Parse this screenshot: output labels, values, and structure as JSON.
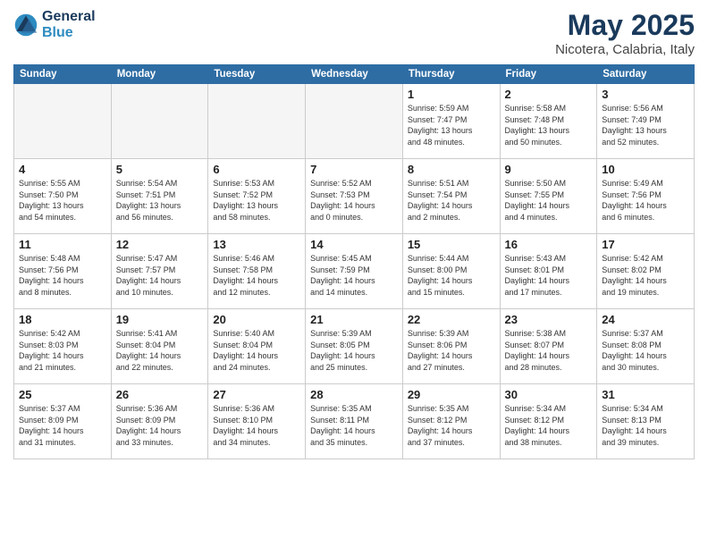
{
  "header": {
    "logo_line1": "General",
    "logo_line2": "Blue",
    "title": "May 2025",
    "subtitle": "Nicotera, Calabria, Italy"
  },
  "days_of_week": [
    "Sunday",
    "Monday",
    "Tuesday",
    "Wednesday",
    "Thursday",
    "Friday",
    "Saturday"
  ],
  "weeks": [
    [
      {
        "day": "",
        "info": ""
      },
      {
        "day": "",
        "info": ""
      },
      {
        "day": "",
        "info": ""
      },
      {
        "day": "",
        "info": ""
      },
      {
        "day": "1",
        "info": "Sunrise: 5:59 AM\nSunset: 7:47 PM\nDaylight: 13 hours\nand 48 minutes."
      },
      {
        "day": "2",
        "info": "Sunrise: 5:58 AM\nSunset: 7:48 PM\nDaylight: 13 hours\nand 50 minutes."
      },
      {
        "day": "3",
        "info": "Sunrise: 5:56 AM\nSunset: 7:49 PM\nDaylight: 13 hours\nand 52 minutes."
      }
    ],
    [
      {
        "day": "4",
        "info": "Sunrise: 5:55 AM\nSunset: 7:50 PM\nDaylight: 13 hours\nand 54 minutes."
      },
      {
        "day": "5",
        "info": "Sunrise: 5:54 AM\nSunset: 7:51 PM\nDaylight: 13 hours\nand 56 minutes."
      },
      {
        "day": "6",
        "info": "Sunrise: 5:53 AM\nSunset: 7:52 PM\nDaylight: 13 hours\nand 58 minutes."
      },
      {
        "day": "7",
        "info": "Sunrise: 5:52 AM\nSunset: 7:53 PM\nDaylight: 14 hours\nand 0 minutes."
      },
      {
        "day": "8",
        "info": "Sunrise: 5:51 AM\nSunset: 7:54 PM\nDaylight: 14 hours\nand 2 minutes."
      },
      {
        "day": "9",
        "info": "Sunrise: 5:50 AM\nSunset: 7:55 PM\nDaylight: 14 hours\nand 4 minutes."
      },
      {
        "day": "10",
        "info": "Sunrise: 5:49 AM\nSunset: 7:56 PM\nDaylight: 14 hours\nand 6 minutes."
      }
    ],
    [
      {
        "day": "11",
        "info": "Sunrise: 5:48 AM\nSunset: 7:56 PM\nDaylight: 14 hours\nand 8 minutes."
      },
      {
        "day": "12",
        "info": "Sunrise: 5:47 AM\nSunset: 7:57 PM\nDaylight: 14 hours\nand 10 minutes."
      },
      {
        "day": "13",
        "info": "Sunrise: 5:46 AM\nSunset: 7:58 PM\nDaylight: 14 hours\nand 12 minutes."
      },
      {
        "day": "14",
        "info": "Sunrise: 5:45 AM\nSunset: 7:59 PM\nDaylight: 14 hours\nand 14 minutes."
      },
      {
        "day": "15",
        "info": "Sunrise: 5:44 AM\nSunset: 8:00 PM\nDaylight: 14 hours\nand 15 minutes."
      },
      {
        "day": "16",
        "info": "Sunrise: 5:43 AM\nSunset: 8:01 PM\nDaylight: 14 hours\nand 17 minutes."
      },
      {
        "day": "17",
        "info": "Sunrise: 5:42 AM\nSunset: 8:02 PM\nDaylight: 14 hours\nand 19 minutes."
      }
    ],
    [
      {
        "day": "18",
        "info": "Sunrise: 5:42 AM\nSunset: 8:03 PM\nDaylight: 14 hours\nand 21 minutes."
      },
      {
        "day": "19",
        "info": "Sunrise: 5:41 AM\nSunset: 8:04 PM\nDaylight: 14 hours\nand 22 minutes."
      },
      {
        "day": "20",
        "info": "Sunrise: 5:40 AM\nSunset: 8:04 PM\nDaylight: 14 hours\nand 24 minutes."
      },
      {
        "day": "21",
        "info": "Sunrise: 5:39 AM\nSunset: 8:05 PM\nDaylight: 14 hours\nand 25 minutes."
      },
      {
        "day": "22",
        "info": "Sunrise: 5:39 AM\nSunset: 8:06 PM\nDaylight: 14 hours\nand 27 minutes."
      },
      {
        "day": "23",
        "info": "Sunrise: 5:38 AM\nSunset: 8:07 PM\nDaylight: 14 hours\nand 28 minutes."
      },
      {
        "day": "24",
        "info": "Sunrise: 5:37 AM\nSunset: 8:08 PM\nDaylight: 14 hours\nand 30 minutes."
      }
    ],
    [
      {
        "day": "25",
        "info": "Sunrise: 5:37 AM\nSunset: 8:09 PM\nDaylight: 14 hours\nand 31 minutes."
      },
      {
        "day": "26",
        "info": "Sunrise: 5:36 AM\nSunset: 8:09 PM\nDaylight: 14 hours\nand 33 minutes."
      },
      {
        "day": "27",
        "info": "Sunrise: 5:36 AM\nSunset: 8:10 PM\nDaylight: 14 hours\nand 34 minutes."
      },
      {
        "day": "28",
        "info": "Sunrise: 5:35 AM\nSunset: 8:11 PM\nDaylight: 14 hours\nand 35 minutes."
      },
      {
        "day": "29",
        "info": "Sunrise: 5:35 AM\nSunset: 8:12 PM\nDaylight: 14 hours\nand 37 minutes."
      },
      {
        "day": "30",
        "info": "Sunrise: 5:34 AM\nSunset: 8:12 PM\nDaylight: 14 hours\nand 38 minutes."
      },
      {
        "day": "31",
        "info": "Sunrise: 5:34 AM\nSunset: 8:13 PM\nDaylight: 14 hours\nand 39 minutes."
      }
    ]
  ]
}
